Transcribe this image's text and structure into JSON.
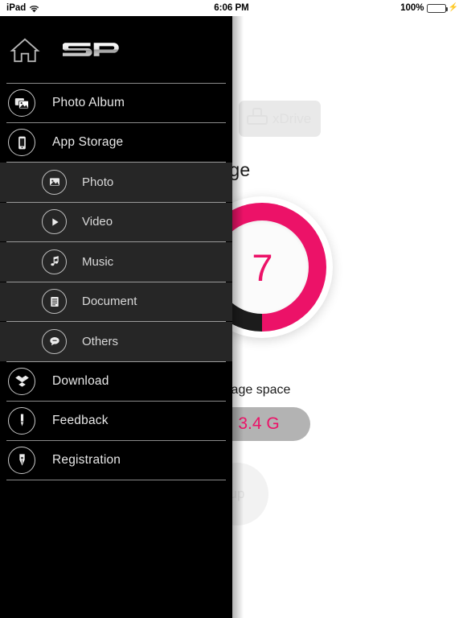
{
  "statusbar": {
    "device": "iPad",
    "wifi_icon": "wifi-icon",
    "time": "6:06 PM",
    "battery_percent": "100%",
    "battery_icon": "battery-icon",
    "charging_icon": "lightning-bolt-icon"
  },
  "background": {
    "xdrive_button": {
      "label": "xDrive",
      "icon": "usb-drive-icon"
    },
    "page_title": "torage",
    "donut": {
      "value": "7",
      "used_color": "#ec1268",
      "free_color": "#1c1c1c"
    },
    "usage_label": "Usage space",
    "usage_value": "3.4 G",
    "backup_label": "up"
  },
  "drawer": {
    "home_icon": "home-icon",
    "brand_logo": "sp-logo",
    "items": [
      {
        "label": "Photo Album",
        "icon": "photo-album-icon"
      },
      {
        "label": "App Storage",
        "icon": "phone-storage-icon"
      }
    ],
    "submenu": [
      {
        "label": "Photo",
        "icon": "image-icon"
      },
      {
        "label": "Video",
        "icon": "play-icon"
      },
      {
        "label": "Music",
        "icon": "music-note-icon"
      },
      {
        "label": "Document",
        "icon": "document-icon"
      },
      {
        "label": "Others",
        "icon": "speech-bubble-icon"
      }
    ],
    "items_lower": [
      {
        "label": "Download",
        "icon": "download-icon"
      },
      {
        "label": "Feedback",
        "icon": "pencil-icon"
      },
      {
        "label": "Registration",
        "icon": "pen-nib-icon"
      }
    ]
  },
  "colors": {
    "accent_pink": "#ec1268",
    "drawer_bg": "#000000",
    "submenu_bg": "#262626",
    "battery_green": "#4cd964"
  }
}
